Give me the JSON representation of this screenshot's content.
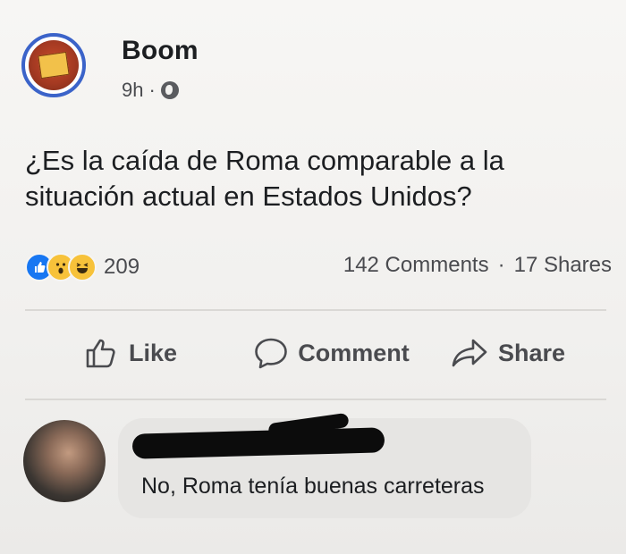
{
  "post": {
    "page_name": "Boom",
    "time": "9h",
    "separator": "·",
    "privacy_icon": "globe-icon",
    "text": "¿Es la caída de Roma comparable a la situación actual en Estados Unidos?"
  },
  "engagement": {
    "reaction_icons": [
      "like-icon",
      "wow-icon",
      "haha-icon"
    ],
    "reaction_count": "209",
    "comments": "142 Comments",
    "separator": "·",
    "shares": "17 Shares"
  },
  "actions": {
    "like": "Like",
    "comment": "Comment",
    "share": "Share"
  },
  "comment": {
    "text": "No, Roma tenía buenas carreteras"
  },
  "colors": {
    "accent": "#1877f2",
    "reaction_yellow": "#f7c23a",
    "text_secondary": "#4a4b4f",
    "avatar_ring": "#3b63c9"
  }
}
